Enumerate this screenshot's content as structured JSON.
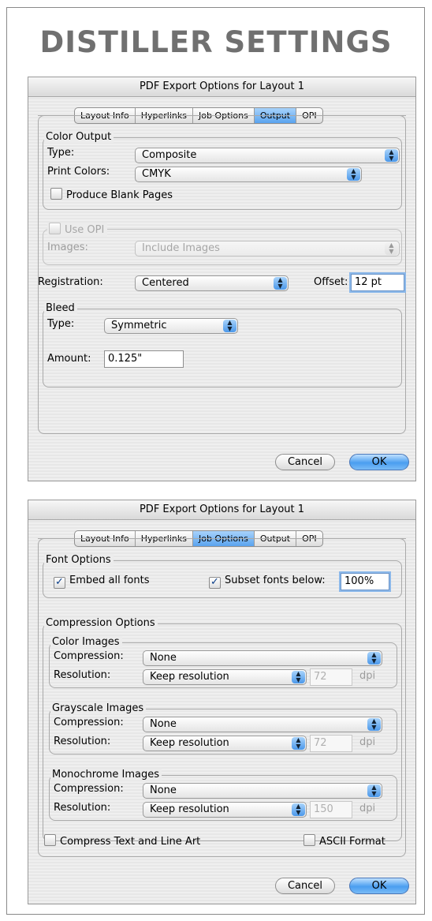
{
  "heading": "DISTILLER SETTINGS",
  "accent_color": "#5aa3ef",
  "tabs": [
    "Layout Info",
    "Hyperlinks",
    "Job Options",
    "Output",
    "OPI"
  ],
  "dialog1": {
    "title": "PDF Export Options for Layout 1",
    "active_tab": "Output",
    "color_output": {
      "title": "Color Output",
      "type_label": "Type:",
      "type_value": "Composite",
      "print_colors_label": "Print Colors:",
      "print_colors_value": "CMYK",
      "blank_pages_label": "Produce Blank Pages",
      "blank_pages_checked": false
    },
    "opi": {
      "use_opi_label": "Use OPI",
      "images_label": "Images:",
      "images_value": "Include Images"
    },
    "registration_label": "Registration:",
    "registration_value": "Centered",
    "offset_label": "Offset:",
    "offset_value": "12 pt",
    "bleed": {
      "title": "Bleed",
      "type_label": "Type:",
      "type_value": "Symmetric",
      "amount_label": "Amount:",
      "amount_value": "0.125\""
    },
    "cancel_label": "Cancel",
    "ok_label": "OK"
  },
  "dialog2": {
    "title": "PDF Export Options for Layout 1",
    "active_tab": "Job Options",
    "font_options": {
      "title": "Font Options",
      "embed_label": "Embed all fonts",
      "embed_checked": true,
      "subset_label": "Subset fonts below:",
      "subset_checked": true,
      "subset_value": "100%"
    },
    "compression": {
      "title": "Compression Options",
      "compression_label": "Compression:",
      "resolution_label": "Resolution:",
      "dpi_label": "dpi",
      "color": {
        "title": "Color Images",
        "compression_value": "None",
        "resolution_value": "Keep resolution",
        "dpi_value": "72"
      },
      "grayscale": {
        "title": "Grayscale Images",
        "compression_value": "None",
        "resolution_value": "Keep resolution",
        "dpi_value": "72"
      },
      "monochrome": {
        "title": "Monochrome Images",
        "compression_value": "None",
        "resolution_value": "Keep resolution",
        "dpi_value": "150"
      }
    },
    "compress_text_label": "Compress Text and Line Art",
    "ascii_label": "ASCII Format",
    "cancel_label": "Cancel",
    "ok_label": "OK"
  }
}
